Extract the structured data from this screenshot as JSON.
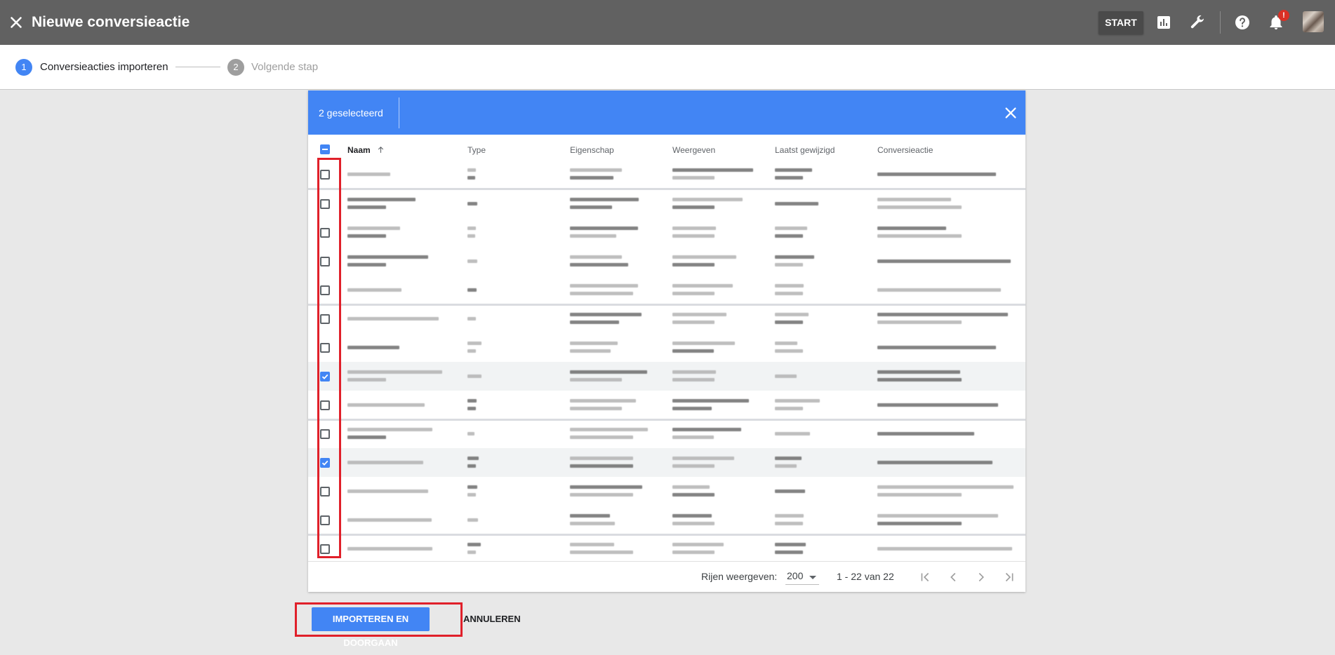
{
  "header": {
    "title": "Nieuwe conversieactie",
    "start_label": "START",
    "notification_badge": "!"
  },
  "stepper": {
    "step1_number": "1",
    "step1_label": "Conversieacties importeren",
    "step2_number": "2",
    "step2_label": "Volgende stap"
  },
  "selection": {
    "count_label": "2 geselecteerd"
  },
  "table": {
    "columns": [
      "Naam",
      "Type",
      "Eigenschap",
      "Weergeven",
      "Laatst gewijzigd",
      "Conversieactie"
    ],
    "rows": [
      {
        "checked": false
      },
      {
        "checked": false
      },
      {
        "checked": false
      },
      {
        "checked": false
      },
      {
        "checked": false
      },
      {
        "checked": false
      },
      {
        "checked": false
      },
      {
        "checked": true
      },
      {
        "checked": false
      },
      {
        "checked": false
      },
      {
        "checked": true
      },
      {
        "checked": false
      },
      {
        "checked": false
      },
      {
        "checked": false
      }
    ]
  },
  "footer": {
    "rows_label": "Rijen weergeven:",
    "rows_value": "200",
    "range_label": "1 - 22 van 22"
  },
  "actions": {
    "import_label": "IMPORTEREN EN DOORGAAN",
    "cancel_label": "ANNULEREN"
  },
  "colors": {
    "accent": "#4285f4",
    "topbar": "#616161",
    "highlight": "#e0202a"
  }
}
